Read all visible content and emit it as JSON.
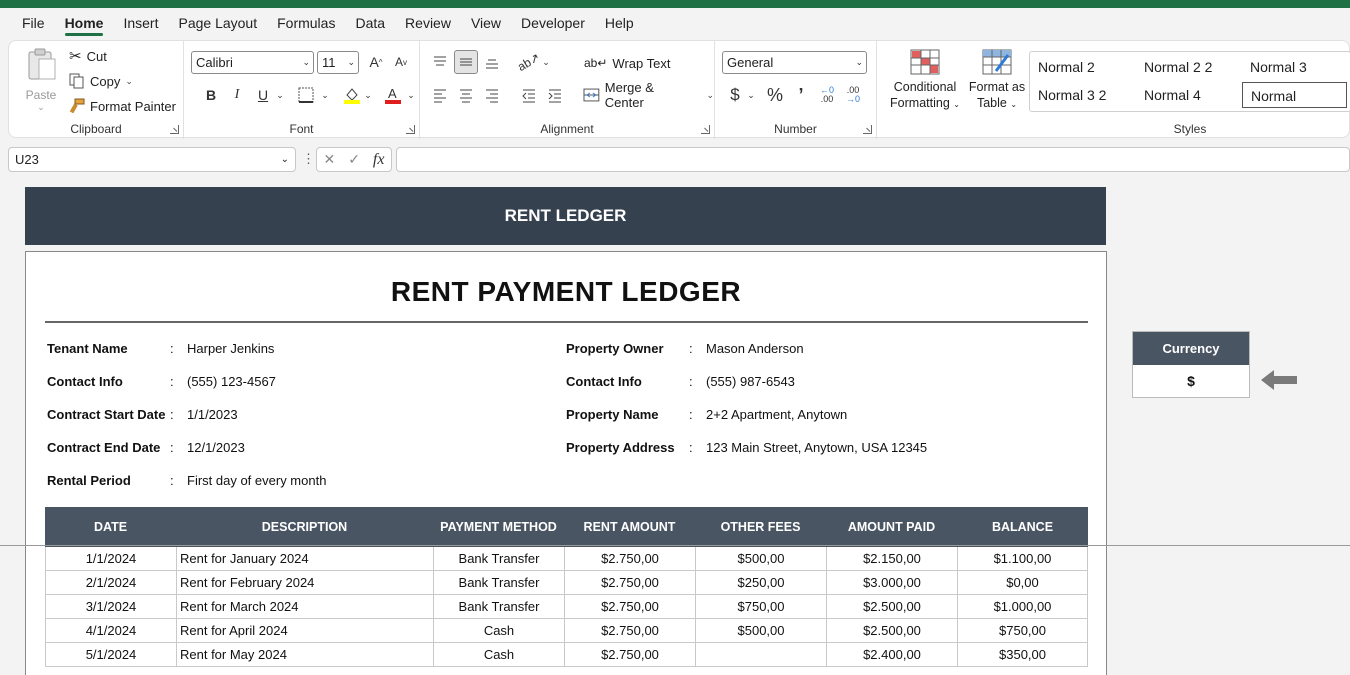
{
  "menu": [
    "File",
    "Home",
    "Insert",
    "Page Layout",
    "Formulas",
    "Data",
    "Review",
    "View",
    "Developer",
    "Help"
  ],
  "active_menu": "Home",
  "clipboard": {
    "paste": "Paste",
    "cut": "Cut",
    "copy": "Copy",
    "format_painter": "Format Painter",
    "label": "Clipboard"
  },
  "font": {
    "name": "Calibri",
    "size": "11",
    "label": "Font"
  },
  "alignment": {
    "wrap_text": "Wrap Text",
    "merge_center": "Merge & Center",
    "label": "Alignment"
  },
  "number": {
    "format": "General",
    "label": "Number"
  },
  "styles": {
    "conditional_1": "Conditional",
    "conditional_2": "Formatting",
    "format_as_1": "Format as",
    "format_as_2": "Table",
    "cells": [
      "Normal 2",
      "Normal 2 2",
      "Normal 3",
      "Normal 3 2",
      "Normal 4",
      "Normal"
    ],
    "label": "Styles"
  },
  "formula_bar": {
    "name_box": "U23",
    "fx": "fx",
    "content": ""
  },
  "sheet": {
    "banner": "RENT LEDGER",
    "title": "RENT PAYMENT LEDGER",
    "tenant": {
      "labels": [
        "Tenant Name",
        "Contact Info",
        "Contract Start Date",
        "Contract End Date",
        "Rental Period"
      ],
      "values": [
        "Harper Jenkins",
        "(555) 123-4567",
        "1/1/2023",
        "12/1/2023",
        "First day of every month"
      ]
    },
    "owner": {
      "labels": [
        "Property Owner",
        "Contact Info",
        "Property Name",
        "Property Address"
      ],
      "values": [
        "Mason Anderson",
        "(555) 987-6543",
        "2+2 Apartment, Anytown",
        "123 Main Street, Anytown, USA 12345"
      ]
    },
    "colon": ":",
    "table": {
      "headers": [
        "DATE",
        "DESCRIPTION",
        "PAYMENT METHOD",
        "RENT AMOUNT",
        "OTHER FEES",
        "AMOUNT PAID",
        "BALANCE"
      ],
      "rows": [
        [
          "1/1/2024",
          "Rent for January 2024",
          "Bank Transfer",
          "$2.750,00",
          "$500,00",
          "$2.150,00",
          "$1.100,00"
        ],
        [
          "2/1/2024",
          "Rent for February 2024",
          "Bank Transfer",
          "$2.750,00",
          "$250,00",
          "$3.000,00",
          "$0,00"
        ],
        [
          "3/1/2024",
          "Rent for March 2024",
          "Bank Transfer",
          "$2.750,00",
          "$750,00",
          "$2.500,00",
          "$1.000,00"
        ],
        [
          "4/1/2024",
          "Rent for April 2024",
          "Cash",
          "$2.750,00",
          "$500,00",
          "$2.500,00",
          "$750,00"
        ],
        [
          "5/1/2024",
          "Rent for May 2024",
          "Cash",
          "$2.750,00",
          "",
          "$2.400,00",
          "$350,00"
        ]
      ]
    },
    "currency": {
      "label": "Currency",
      "value": "$"
    }
  }
}
